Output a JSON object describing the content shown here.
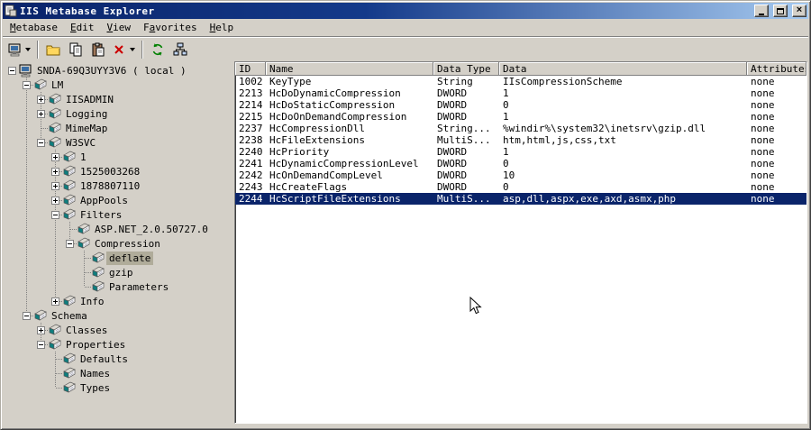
{
  "window": {
    "title": "IIS Metabase Explorer"
  },
  "menu": {
    "items": [
      {
        "label": "Metabase",
        "accel": 0
      },
      {
        "label": "Edit",
        "accel": 0
      },
      {
        "label": "View",
        "accel": 0
      },
      {
        "label": "Favorites",
        "accel": 1
      },
      {
        "label": "Help",
        "accel": 0
      }
    ]
  },
  "toolbar": {
    "buttons": [
      {
        "name": "connect",
        "icon": "computer-icon",
        "dropdown": true
      },
      {
        "separator": true
      },
      {
        "name": "new-key",
        "icon": "folder-icon"
      },
      {
        "name": "copy",
        "icon": "copy-icon"
      },
      {
        "name": "paste",
        "icon": "paste-icon"
      },
      {
        "name": "delete",
        "icon": "delete-x-icon",
        "dropdown": true
      },
      {
        "separator": true
      },
      {
        "name": "refresh",
        "icon": "refresh-icon"
      },
      {
        "name": "view-hierarchy",
        "icon": "hierarchy-icon"
      }
    ]
  },
  "tree": {
    "items": [
      {
        "label": "SNDA-69Q3UYY3V6 ( local )",
        "depth": 0,
        "expander": "minus",
        "icon": "computer-icon",
        "selected": false
      },
      {
        "label": "LM",
        "depth": 1,
        "expander": "minus",
        "icon": "node-icon",
        "selected": false
      },
      {
        "label": "IISADMIN",
        "depth": 2,
        "expander": "plus",
        "icon": "node-icon",
        "selected": false
      },
      {
        "label": "Logging",
        "depth": 2,
        "expander": "plus",
        "icon": "node-icon",
        "selected": false
      },
      {
        "label": "MimeMap",
        "depth": 2,
        "expander": "none",
        "icon": "node-icon",
        "selected": false
      },
      {
        "label": "W3SVC",
        "depth": 2,
        "expander": "minus",
        "icon": "node-icon",
        "selected": false
      },
      {
        "label": "1",
        "depth": 3,
        "expander": "plus",
        "icon": "node-icon",
        "selected": false
      },
      {
        "label": "1525003268",
        "depth": 3,
        "expander": "plus",
        "icon": "node-icon",
        "selected": false
      },
      {
        "label": "1878807110",
        "depth": 3,
        "expander": "plus",
        "icon": "node-icon",
        "selected": false
      },
      {
        "label": "AppPools",
        "depth": 3,
        "expander": "plus",
        "icon": "node-icon",
        "selected": false
      },
      {
        "label": "Filters",
        "depth": 3,
        "expander": "minus",
        "icon": "node-icon",
        "selected": false
      },
      {
        "label": "ASP.NET_2.0.50727.0",
        "depth": 4,
        "expander": "none",
        "icon": "node-icon",
        "selected": false
      },
      {
        "label": "Compression",
        "depth": 4,
        "expander": "minus",
        "icon": "node-icon",
        "selected": false
      },
      {
        "label": "deflate",
        "depth": 5,
        "expander": "none",
        "icon": "node-icon",
        "selected": true
      },
      {
        "label": "gzip",
        "depth": 5,
        "expander": "none",
        "icon": "node-icon",
        "selected": false
      },
      {
        "label": "Parameters",
        "depth": 5,
        "expander": "none",
        "icon": "node-icon",
        "selected": false
      },
      {
        "label": "Info",
        "depth": 3,
        "expander": "plus",
        "icon": "node-icon",
        "selected": false
      },
      {
        "label": "Schema",
        "depth": 1,
        "expander": "minus",
        "icon": "node-icon",
        "selected": false
      },
      {
        "label": "Classes",
        "depth": 2,
        "expander": "plus",
        "icon": "node-icon",
        "selected": false
      },
      {
        "label": "Properties",
        "depth": 2,
        "expander": "minus",
        "icon": "node-icon",
        "selected": false
      },
      {
        "label": "Defaults",
        "depth": 3,
        "expander": "none",
        "icon": "node-icon",
        "selected": false
      },
      {
        "label": "Names",
        "depth": 3,
        "expander": "none",
        "icon": "node-icon",
        "selected": false
      },
      {
        "label": "Types",
        "depth": 3,
        "expander": "none",
        "icon": "node-icon",
        "selected": false
      }
    ]
  },
  "list": {
    "columns": [
      "ID",
      "Name",
      "Data Type",
      "Data",
      "Attributes"
    ],
    "rows": [
      {
        "cells": [
          "1002",
          "KeyType",
          "String",
          "IIsCompressionScheme",
          "none"
        ],
        "selected": false
      },
      {
        "cells": [
          "2213",
          "HcDoDynamicCompression",
          "DWORD",
          "1",
          "none"
        ],
        "selected": false
      },
      {
        "cells": [
          "2214",
          "HcDoStaticCompression",
          "DWORD",
          "0",
          "none"
        ],
        "selected": false
      },
      {
        "cells": [
          "2215",
          "HcDoOnDemandCompression",
          "DWORD",
          "1",
          "none"
        ],
        "selected": false
      },
      {
        "cells": [
          "2237",
          "HcCompressionDll",
          "String...",
          "%windir%\\system32\\inetsrv\\gzip.dll",
          "none"
        ],
        "selected": false
      },
      {
        "cells": [
          "2238",
          "HcFileExtensions",
          "MultiS...",
          "htm,html,js,css,txt",
          "none"
        ],
        "selected": false
      },
      {
        "cells": [
          "2240",
          "HcPriority",
          "DWORD",
          "1",
          "none"
        ],
        "selected": false
      },
      {
        "cells": [
          "2241",
          "HcDynamicCompressionLevel",
          "DWORD",
          "0",
          "none"
        ],
        "selected": false
      },
      {
        "cells": [
          "2242",
          "HcOnDemandCompLevel",
          "DWORD",
          "10",
          "none"
        ],
        "selected": false
      },
      {
        "cells": [
          "2243",
          "HcCreateFlags",
          "DWORD",
          "0",
          "none"
        ],
        "selected": false
      },
      {
        "cells": [
          "2244",
          "HcScriptFileExtensions",
          "MultiS...",
          "asp,dll,aspx,exe,axd,asmx,php",
          "none"
        ],
        "selected": true
      }
    ]
  },
  "colors": {
    "titlebar_left": "#0a246a",
    "titlebar_right": "#a6caf0",
    "selection": "#0a246a",
    "chrome": "#d4d0c8",
    "inactive_selection": "#b0ac9a"
  }
}
